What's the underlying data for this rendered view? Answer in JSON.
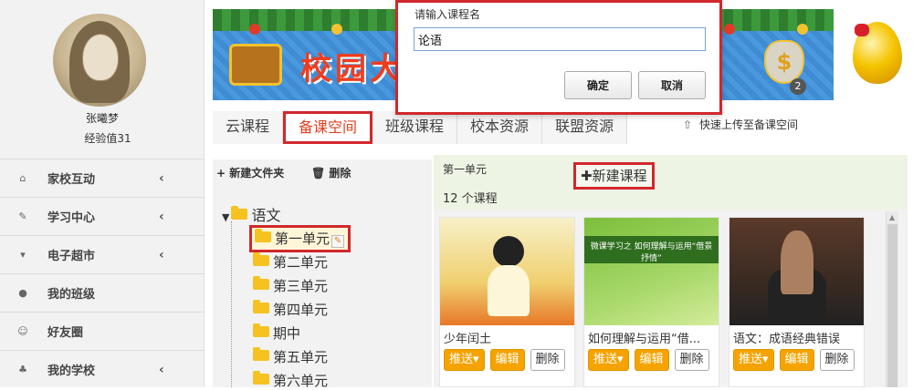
{
  "user": {
    "name": "张曦梦",
    "exp": "经验值31"
  },
  "sidebar": {
    "items": [
      {
        "icon": "home-icon",
        "glyph": "⌂",
        "label": "家校互动",
        "chevron": "‹"
      },
      {
        "icon": "edit-icon",
        "glyph": "✎",
        "label": "学习中心",
        "chevron": "‹"
      },
      {
        "icon": "cart-icon",
        "glyph": "▾",
        "label": "电子超市",
        "chevron": "‹"
      },
      {
        "icon": "user-icon",
        "glyph": "●",
        "label": "我的班级",
        "chevron": ""
      },
      {
        "icon": "smile-icon",
        "glyph": "☺",
        "label": "好友圈",
        "chevron": ""
      },
      {
        "icon": "sitemap-icon",
        "glyph": "♣",
        "label": "我的学校",
        "chevron": "‹"
      }
    ]
  },
  "banner": {
    "title": "校园大",
    "coin_badge": "2"
  },
  "tabs": [
    {
      "label": "云课程",
      "active": false
    },
    {
      "label": "备课空间",
      "active": true
    },
    {
      "label": "班级课程",
      "active": false
    },
    {
      "label": "校本资源",
      "active": false
    },
    {
      "label": "联盟资源",
      "active": false
    }
  ],
  "upload_quick": "快速上传至备课空间",
  "tree_toolbar": {
    "new_folder": "+ 新建文件夹",
    "delete": "🗑 删除"
  },
  "tree": {
    "root": "语文",
    "items": [
      "第一单元",
      "第二单元",
      "第三单元",
      "第四单元",
      "期中",
      "第五单元",
      "第六单元"
    ]
  },
  "main": {
    "unit_title": "第一单元",
    "new_course": "✚新建课程",
    "course_count": "12 个课程"
  },
  "courses": [
    {
      "title": "少年闰土",
      "thumb_text": ""
    },
    {
      "title": "如何理解与运用“借...",
      "thumb_text": "微课学习之 如何理解与运用“借景抒情”"
    },
    {
      "title": "语文：成语经典错误",
      "thumb_text": ""
    }
  ],
  "card_buttons": {
    "push": "推送▾",
    "edit": "编辑",
    "delete": "删除"
  },
  "dialog": {
    "prompt": "请输入课程名",
    "input_value": "论语",
    "ok": "确定",
    "cancel": "取消"
  },
  "colors": {
    "accent": "#d0282c",
    "button_orange": "#f5a300",
    "header_green": "#eef4e4"
  }
}
